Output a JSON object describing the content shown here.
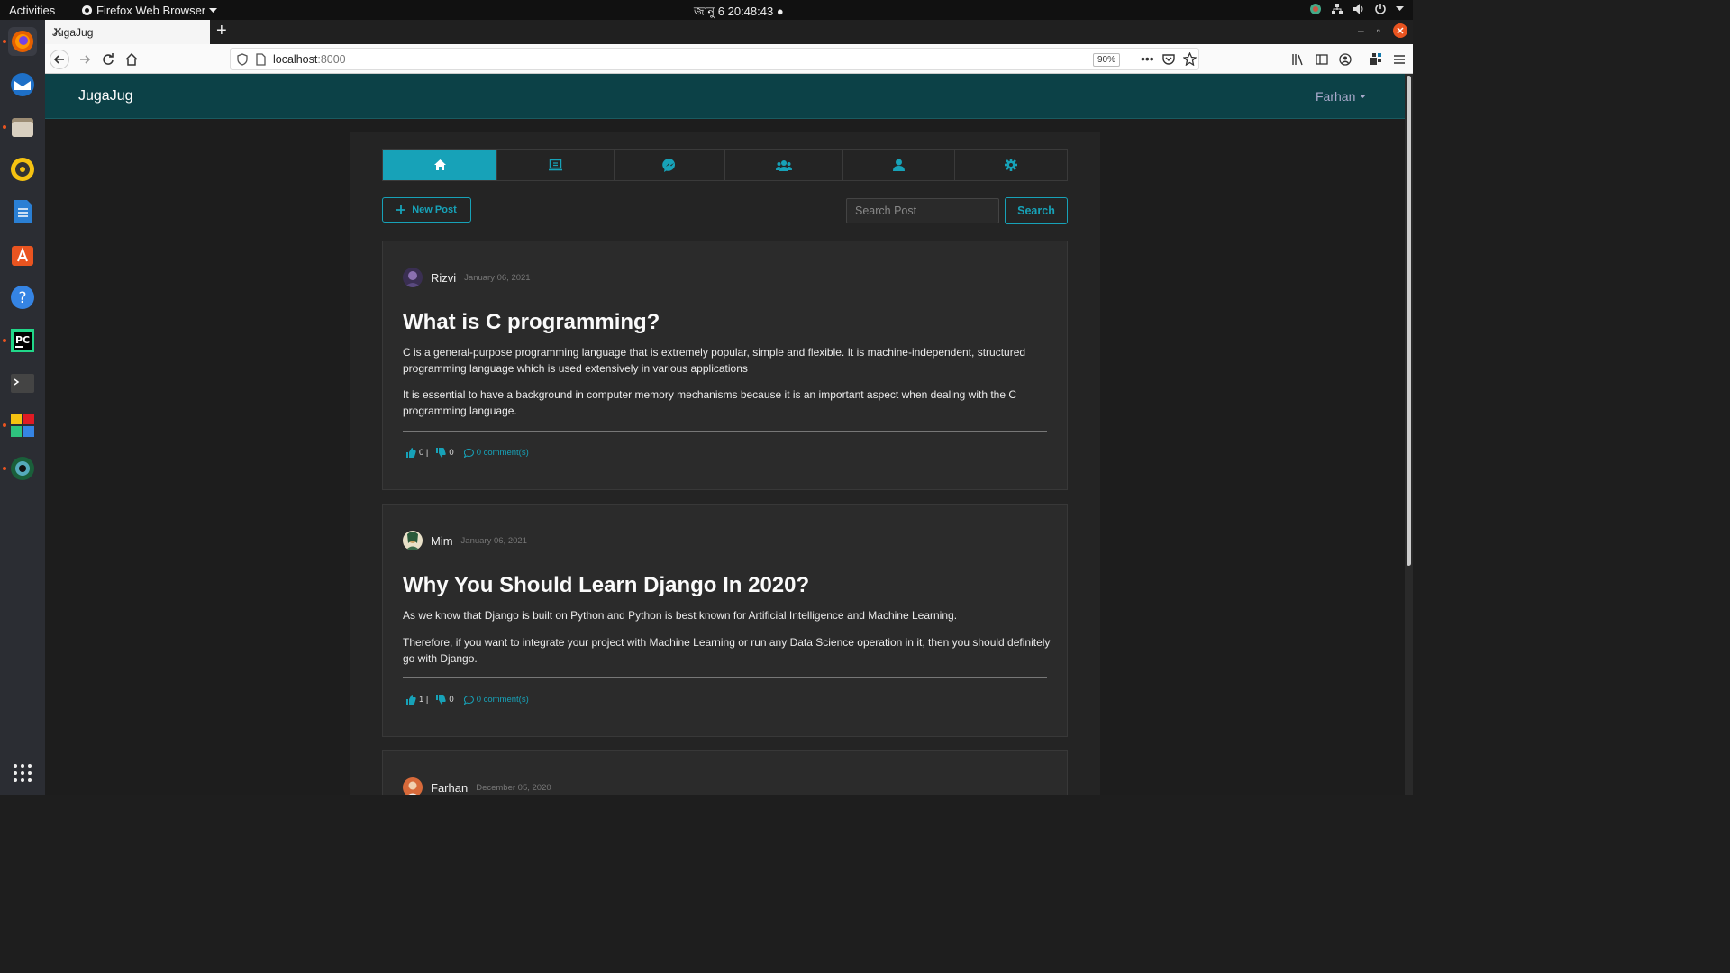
{
  "system": {
    "activities": "Activities",
    "app_name": "Firefox Web Browser",
    "clock": "জানু 6  20:48:43"
  },
  "browser": {
    "tab_title": "JugaJug",
    "url_host": "localhost",
    "url_port": ":8000",
    "zoom": "90%"
  },
  "site": {
    "brand": "JugaJug",
    "user": "Farhan",
    "nav_tabs": [
      {
        "icon": "home-icon",
        "active": true
      },
      {
        "icon": "feed-icon",
        "active": false
      },
      {
        "icon": "messenger-icon",
        "active": false
      },
      {
        "icon": "friends-icon",
        "active": false
      },
      {
        "icon": "profile-icon",
        "active": false
      },
      {
        "icon": "settings-icon",
        "active": false
      }
    ],
    "new_post_label": "New Post",
    "search_placeholder": "Search Post",
    "search_button": "Search",
    "accent": "#17a2b8",
    "header_bg": "#0c4147"
  },
  "posts": [
    {
      "author": "Rizvi",
      "date": "January 06, 2021",
      "title": "What is C programming?",
      "paragraphs": [
        "C is a general-purpose programming language that is extremely popular, simple and flexible. It is machine-independent, structured programming language which is used extensively in various applications",
        "It is essential to have a background in computer memory mechanisms because it is an important aspect when dealing with the C programming language."
      ],
      "likes": "0 |",
      "dislikes": "0",
      "comments": "0 comment(s)"
    },
    {
      "author": "Mim",
      "date": "January 06, 2021",
      "title": "Why You Should Learn Django In 2020?",
      "paragraphs": [
        "As we know that Django is built on Python and Python is best known for Artificial Intelligence and Machine Learning.",
        "Therefore, if you want to integrate your project with Machine Learning or run any Data Science operation in it, then you should definitely go with Django."
      ],
      "likes": "1 |",
      "dislikes": "0",
      "comments": "0 comment(s)"
    },
    {
      "author": "Farhan",
      "date": "December 05, 2020"
    }
  ]
}
